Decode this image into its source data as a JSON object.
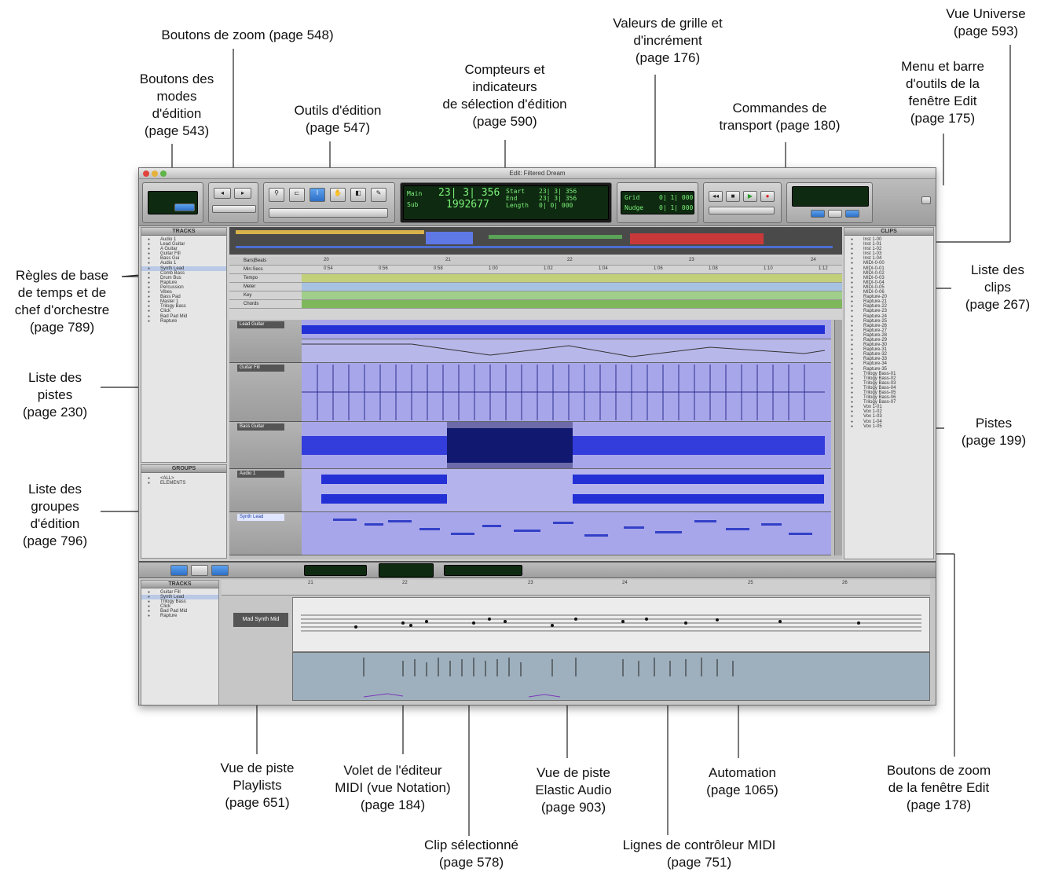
{
  "labels": {
    "zoom_buttons": "Boutons de zoom (page 548)",
    "edit_modes": "Boutons des\nmodes\nd'édition\n(page 543)",
    "edit_tools": "Outils d'édition\n(page 547)",
    "counters": "Compteurs et\nindicateurs\nde sélection d'édition\n(page 590)",
    "grid_values": "Valeurs de grille et\nd'incrément\n(page 176)",
    "universe": "Vue Universe\n(page 593)",
    "menu_toolbar": "Menu et barre\nd'outils de la\nfenêtre Edit\n(page 175)",
    "transport": "Commandes de\ntransport (page 180)",
    "rulers": "Règles de base\nde temps et de\nchef d'orchestre\n(page 789)",
    "track_list": "Liste des\npistes\n(page 230)",
    "group_list": "Liste des\ngroupes\nd'édition\n(page 796)",
    "clip_list": "Liste des\nclips\n(page 267)",
    "tracks": "Pistes\n(page 199)",
    "playlists": "Vue de piste\nPlaylists\n(page 651)",
    "midi_editor": "Volet de l'éditeur\nMIDI (vue Notation)\n(page 184)",
    "elastic": "Vue de piste\nElastic Audio\n(page 903)",
    "automation": "Automation\n(page 1065)",
    "edit_zoom": "Boutons de zoom\nde la fenêtre Edit\n(page 178)",
    "selected_clip": "Clip sélectionné\n(page 578)",
    "midi_ctrl": "Lignes de contrôleur MIDI\n(page 751)"
  },
  "window": {
    "title": "Edit: Filtered Dream",
    "tracks_header": "TRACKS",
    "groups_header": "GROUPS",
    "clips_header": "CLIPS",
    "counter_main": "23| 3| 356",
    "counter_sub": "1992677",
    "counter_main_label": "Main",
    "counter_sub_label": "Sub",
    "start_label": "Start",
    "end_label": "End",
    "length_label": "Length",
    "start_val": "23| 3| 356",
    "end_val": "23| 3| 356",
    "length_val": "0| 0| 000",
    "grid_label": "Grid",
    "nudge_label": "Nudge",
    "grid_val": "0| 1| 000",
    "nudge_val": "0| 1| 000",
    "ruler_bars": "Bars|Beats",
    "ruler_min": "Min:Secs",
    "ruler_tempo": "Tempo",
    "ruler_meter": "Meter",
    "ruler_key": "Key",
    "ruler_chords": "Chords",
    "track_names": [
      "Lead Guitar",
      "Guitar Fill",
      "Bass Guitar",
      "Audio 1",
      "Synth Lead"
    ],
    "midi_track": "Mad Synth Mid",
    "midi_tracks_header": "TRACKS",
    "bar_ticks": [
      "20",
      "21",
      "22",
      "23",
      "24",
      "25",
      "26"
    ],
    "time_ticks": [
      "0:54",
      "0:56",
      "0:58",
      "1:00",
      "1:02",
      "1:04",
      "1:06",
      "1:08",
      "1:10",
      "1:12"
    ],
    "track_list": [
      "Audio 1",
      "Lead Guitar",
      "A Guitar",
      "Guitar Fill",
      "Bass Gui",
      "Audio 1",
      "Synth Lead",
      "Comb Bass",
      "Drum Bus",
      "Rapture",
      "Percussion",
      "Vibes",
      "Bass Pad",
      "Master 1",
      "Trilogy Bass",
      "Click",
      "Bad Pad Mid",
      "Rapture"
    ],
    "group_list": [
      "<ALL>",
      "ELEMENTS"
    ],
    "clip_list": [
      "Inst 1-00",
      "Inst 1-01",
      "Inst 1-02",
      "Inst 1-03",
      "Inst 1-04",
      "MIDI-0-00",
      "MIDI-0-01",
      "MIDI-0-02",
      "MIDI-0-03",
      "MIDI-0-04",
      "MIDI-0-05",
      "MIDI-0-06",
      "Rapture-20",
      "Rapture-21",
      "Rapture-22",
      "Rapture-23",
      "Rapture-24",
      "Rapture-25",
      "Rapture-26",
      "Rapture-27",
      "Rapture-28",
      "Rapture-29",
      "Rapture-30",
      "Rapture-31",
      "Rapture-32",
      "Rapture-33",
      "Rapture-34",
      "Rapture-35",
      "Trilogy Bass-01",
      "Trilogy Bass-02",
      "Trilogy Bass-03",
      "Trilogy Bass-04",
      "Trilogy Bass-05",
      "Trilogy Bass-06",
      "Trilogy Bass-07",
      "Vox 1-01",
      "Vox 1-02",
      "Vox 1-03",
      "Vox 1-04",
      "Vox 1-05"
    ],
    "midi_track_list": [
      "Guitar Fill",
      "Synth Lead",
      "Trilogy Bass",
      "Click",
      "Bad Pad Mid",
      "Rapture"
    ]
  },
  "colors": {
    "accent_blue": "#3d6fd8",
    "audio_wave": "#1f2ad8",
    "lane_bg": "#a8a6ea",
    "green_lcd": "#7cf27a"
  }
}
